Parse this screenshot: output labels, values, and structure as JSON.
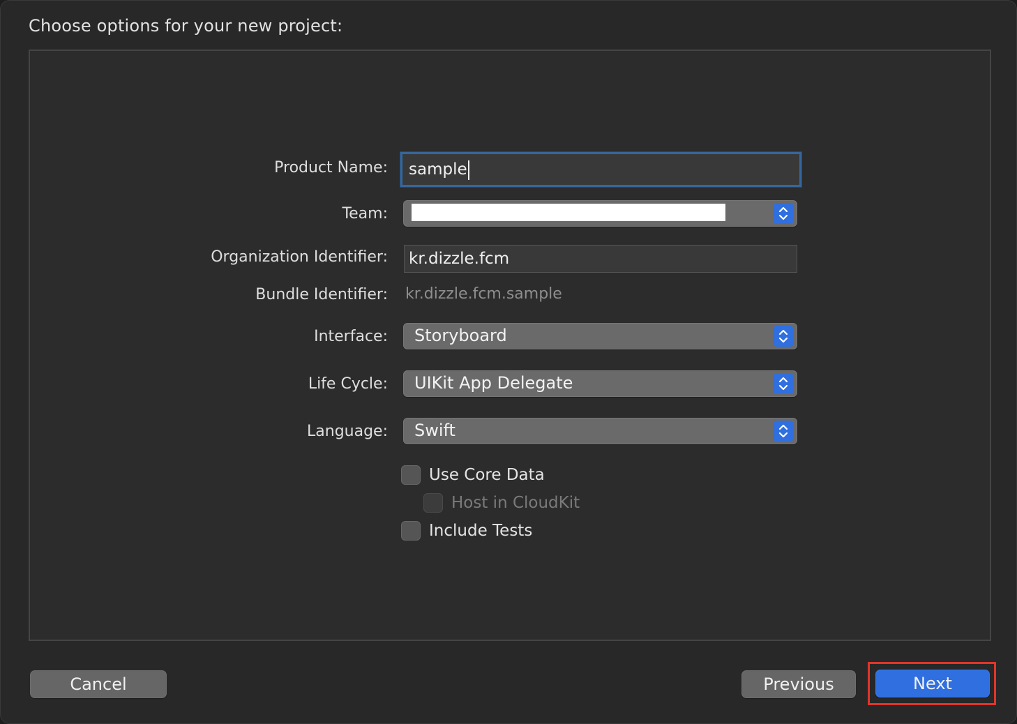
{
  "dialog": {
    "heading": "Choose options for your new project:"
  },
  "form": {
    "product_name": {
      "label": "Product Name:",
      "value": "sample"
    },
    "team": {
      "label": "Team:",
      "value": ""
    },
    "organization_identifier": {
      "label": "Organization Identifier:",
      "value": "kr.dizzle.fcm"
    },
    "bundle_identifier": {
      "label": "Bundle Identifier:",
      "value": "kr.dizzle.fcm.sample"
    },
    "interface": {
      "label": "Interface:",
      "value": "Storyboard"
    },
    "life_cycle": {
      "label": "Life Cycle:",
      "value": "UIKit App Delegate"
    },
    "language": {
      "label": "Language:",
      "value": "Swift"
    },
    "use_core_data": {
      "label": "Use Core Data",
      "checked": false
    },
    "host_in_cloudkit": {
      "label": "Host in CloudKit",
      "checked": false,
      "enabled": false
    },
    "include_tests": {
      "label": "Include Tests",
      "checked": false
    }
  },
  "buttons": {
    "cancel": "Cancel",
    "previous": "Previous",
    "next": "Next"
  },
  "colors": {
    "accent": "#2f6fe0",
    "highlight": "#e0352b",
    "focus_ring": "#35679e"
  },
  "icons": {
    "popup_stepper": "up-down-chevron-icon"
  }
}
